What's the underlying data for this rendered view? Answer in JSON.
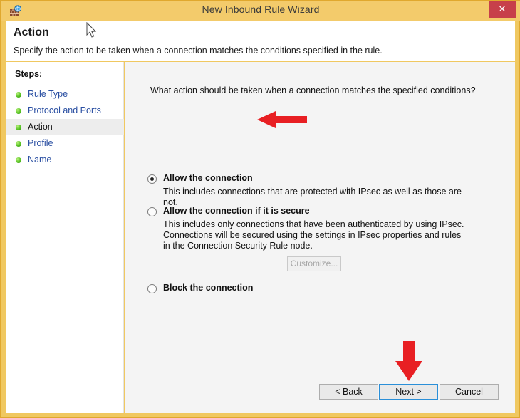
{
  "window": {
    "title": "New Inbound Rule Wizard",
    "icon": "firewall-globe-icon",
    "close_label": "✕",
    "titlebar_color": "#f3cb6b",
    "border_color": "#e0a82e",
    "close_color": "#c7404a"
  },
  "header": {
    "title": "Action",
    "subtitle": "Specify the action to be taken when a connection matches the conditions specified in the rule."
  },
  "sidebar": {
    "heading": "Steps:",
    "items": [
      {
        "label": "Rule Type",
        "current": false
      },
      {
        "label": "Protocol and Ports",
        "current": false
      },
      {
        "label": "Action",
        "current": true
      },
      {
        "label": "Profile",
        "current": false
      },
      {
        "label": "Name",
        "current": false
      }
    ],
    "link_color": "#2a4fa2",
    "current_color": "#111111"
  },
  "main": {
    "question": "What action should be taken when a connection matches the specified conditions?",
    "options": [
      {
        "id": "allow",
        "title": "Allow the connection",
        "description": "This includes connections that are protected with IPsec as well as those are not.",
        "selected": true
      },
      {
        "id": "allow-secure",
        "title": "Allow the connection if it is secure",
        "description": "This includes only connections that have been authenticated by using IPsec.  Connections will be secured using the settings in IPsec properties and rules in the Connection Security Rule node.",
        "selected": false
      },
      {
        "id": "block",
        "title": "Block the connection",
        "description": "",
        "selected": false
      }
    ],
    "customize_label": "Customize...",
    "customize_enabled": false
  },
  "footer": {
    "back_label": "< Back",
    "next_label": "Next >",
    "cancel_label": "Cancel",
    "focused_button": "Next >"
  },
  "annotations": {
    "color": "#e81f23",
    "arrow_left": "points-at-allow-the-connection",
    "arrow_down": "points-at-next-button"
  }
}
